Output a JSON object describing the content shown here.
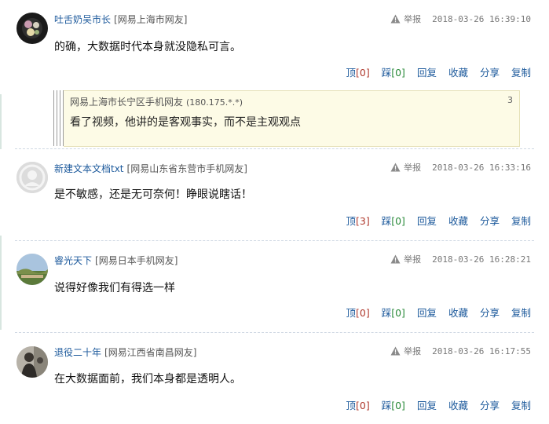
{
  "comments": [
    {
      "username": "吐舌奶吴市长",
      "location": "[网易上海市网友]",
      "report": "举报",
      "time": "2018-03-26 16:39:10",
      "text": "的确，大数据时代本身就没隐私可言。",
      "up": {
        "label": "顶",
        "count": "[0]"
      },
      "down": {
        "label": "踩",
        "count": "[0]"
      },
      "reply": "回复",
      "favorite": "收藏",
      "share": "分享",
      "copy": "复制",
      "quote": {
        "user": "网易上海市长宁区手机网友",
        "ip": "(180.175.*.*)",
        "floor": "3",
        "text": "看了视频，他讲的是客观事实，而不是主观观点"
      }
    },
    {
      "username": "新建文本文档txt",
      "location": "[网易山东省东营市手机网友]",
      "report": "举报",
      "time": "2018-03-26 16:33:16",
      "text": "是不敏感，还是无可奈何！睁眼说瞎话！",
      "up": {
        "label": "顶",
        "count": "[3]"
      },
      "down": {
        "label": "踩",
        "count": "[0]"
      },
      "reply": "回复",
      "favorite": "收藏",
      "share": "分享",
      "copy": "复制"
    },
    {
      "username": "睿光天下",
      "location": "[网易日本手机网友]",
      "report": "举报",
      "time": "2018-03-26 16:28:21",
      "text": "说得好像我们有得选一样",
      "up": {
        "label": "顶",
        "count": "[0]"
      },
      "down": {
        "label": "踩",
        "count": "[0]"
      },
      "reply": "回复",
      "favorite": "收藏",
      "share": "分享",
      "copy": "复制"
    },
    {
      "username": "退役二十年",
      "location": "[网易江西省南昌网友]",
      "report": "举报",
      "time": "2018-03-26 16:17:55",
      "text": "在大数据面前，我们本身都是透明人。",
      "up": {
        "label": "顶",
        "count": "[0]"
      },
      "down": {
        "label": "踩",
        "count": "[0]"
      },
      "reply": "回复",
      "favorite": "收藏",
      "share": "分享",
      "copy": "复制"
    }
  ]
}
